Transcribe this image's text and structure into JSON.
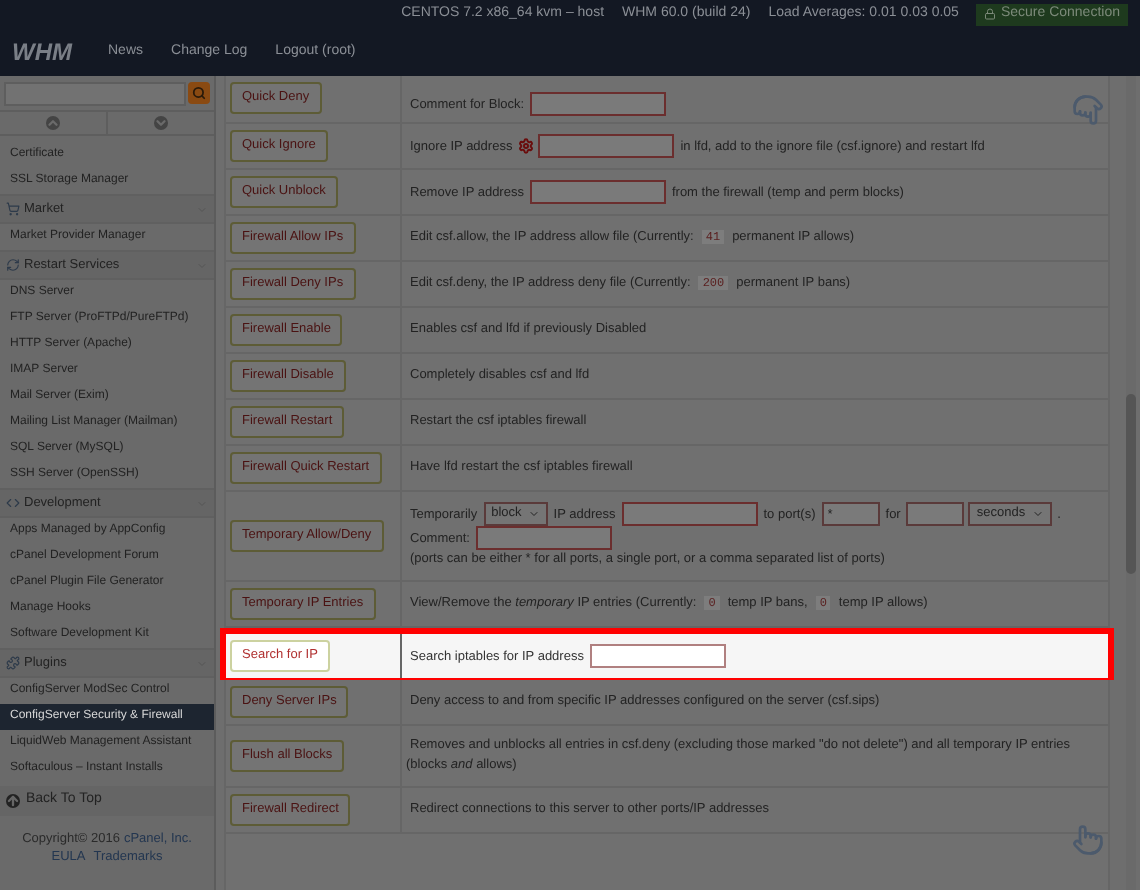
{
  "header": {
    "info": [
      "CENTOS 7.2 x86_64 kvm – host",
      "WHM 60.0 (build 24)",
      "Load Averages: 0.01 0.03 0.05"
    ],
    "secure": "Secure Connection",
    "logo": "WHM",
    "nav": [
      "News",
      "Change Log",
      "Logout (root)"
    ]
  },
  "sidebar": {
    "items": [
      {
        "kind": "item",
        "label": "Certificate",
        "selected": false
      },
      {
        "kind": "item",
        "label": "SSL Storage Manager",
        "selected": false
      },
      {
        "kind": "group",
        "label": "Market",
        "selected": false
      },
      {
        "kind": "item",
        "label": "Market Provider Manager",
        "selected": false
      },
      {
        "kind": "group",
        "label": "Restart Services",
        "selected": false
      },
      {
        "kind": "item",
        "label": "DNS Server",
        "selected": false
      },
      {
        "kind": "item",
        "label": "FTP Server (ProFTPd/PureFTPd)",
        "selected": false
      },
      {
        "kind": "item",
        "label": "HTTP Server (Apache)",
        "selected": false
      },
      {
        "kind": "item",
        "label": "IMAP Server",
        "selected": false
      },
      {
        "kind": "item",
        "label": "Mail Server (Exim)",
        "selected": false
      },
      {
        "kind": "item",
        "label": "Mailing List Manager (Mailman)",
        "selected": false
      },
      {
        "kind": "item",
        "label": "SQL Server (MySQL)",
        "selected": false
      },
      {
        "kind": "item",
        "label": "SSH Server (OpenSSH)",
        "selected": false
      },
      {
        "kind": "group",
        "label": "Development",
        "selected": false
      },
      {
        "kind": "item",
        "label": "Apps Managed by AppConfig",
        "selected": false
      },
      {
        "kind": "item",
        "label": "cPanel Development Forum",
        "selected": false
      },
      {
        "kind": "item",
        "label": "cPanel Plugin File Generator",
        "selected": false
      },
      {
        "kind": "item",
        "label": "Manage Hooks",
        "selected": false
      },
      {
        "kind": "item",
        "label": "Software Development Kit",
        "selected": false
      },
      {
        "kind": "group",
        "label": "Plugins",
        "selected": false
      },
      {
        "kind": "item",
        "label": "ConfigServer ModSec Control",
        "selected": false
      },
      {
        "kind": "item",
        "label": "ConfigServer Security & Firewall",
        "selected": true
      },
      {
        "kind": "item",
        "label": "LiquidWeb Management Assistant",
        "selected": false
      },
      {
        "kind": "item",
        "label": "Softaculous – Instant Installs",
        "selected": false
      }
    ],
    "back_to_top": "Back To Top",
    "copyright": "Copyright© 2016",
    "company": "cPanel, Inc.",
    "links": [
      "EULA",
      "Trademarks"
    ]
  },
  "rows": [
    {
      "button": "Quick Deny",
      "highlighted": false,
      "parts": [
        {
          "kind": "text",
          "text": "Comment for Block:"
        },
        {
          "kind": "field"
        }
      ]
    },
    {
      "button": "Quick Ignore",
      "highlighted": false,
      "parts": [
        {
          "kind": "text",
          "text": "Ignore IP address"
        },
        {
          "kind": "gear"
        },
        {
          "kind": "field"
        },
        {
          "kind": "text",
          "text": "in lfd, add to the ignore file (csf.ignore) and restart lfd"
        }
      ]
    },
    {
      "button": "Quick Unblock",
      "highlighted": false,
      "parts": [
        {
          "kind": "text",
          "text": "Remove IP address"
        },
        {
          "kind": "field"
        },
        {
          "kind": "text",
          "text": "from the firewall (temp and perm blocks)"
        }
      ]
    },
    {
      "button": "Firewall Allow IPs",
      "highlighted": false,
      "parts": [
        {
          "kind": "text",
          "text": "Edit csf.allow, the IP address allow file (Currently:"
        },
        {
          "kind": "code",
          "text": "41"
        },
        {
          "kind": "text",
          "text": "permanent IP allows)"
        }
      ]
    },
    {
      "button": "Firewall Deny IPs",
      "highlighted": false,
      "parts": [
        {
          "kind": "text",
          "text": "Edit csf.deny, the IP address deny file (Currently:"
        },
        {
          "kind": "code",
          "text": "200"
        },
        {
          "kind": "text",
          "text": "permanent IP bans)"
        }
      ]
    },
    {
      "button": "Firewall Enable",
      "highlighted": false,
      "parts": [
        {
          "kind": "text",
          "text": "Enables csf and lfd if previously Disabled"
        }
      ]
    },
    {
      "button": "Firewall Disable",
      "highlighted": false,
      "parts": [
        {
          "kind": "text",
          "text": "Completely disables csf and lfd"
        }
      ]
    },
    {
      "button": "Firewall Restart",
      "highlighted": false,
      "parts": [
        {
          "kind": "text",
          "text": "Restart the csf iptables firewall"
        }
      ]
    },
    {
      "button": "Firewall Quick Restart",
      "highlighted": false,
      "parts": [
        {
          "kind": "text",
          "text": "Have lfd restart the csf iptables firewall"
        }
      ]
    },
    {
      "button": "Temporary Allow/Deny",
      "highlighted": false,
      "parts": [
        {
          "kind": "text",
          "text": "Temporarily"
        },
        {
          "kind": "select",
          "value": "block"
        },
        {
          "kind": "text",
          "text": "IP address"
        },
        {
          "kind": "field"
        },
        {
          "kind": "text",
          "text": "to port(s)"
        },
        {
          "kind": "small-field",
          "value": "*"
        },
        {
          "kind": "text",
          "text": "for"
        },
        {
          "kind": "small-field"
        },
        {
          "kind": "select",
          "value": "seconds"
        },
        {
          "kind": "text",
          "text": "."
        },
        {
          "kind": "break"
        },
        {
          "kind": "text",
          "text": "Comment:"
        },
        {
          "kind": "field"
        },
        {
          "kind": "break"
        },
        {
          "kind": "text",
          "text": "(ports can be either * for all ports, a single port, or a comma separated list of ports)"
        }
      ]
    },
    {
      "button": "Temporary IP Entries",
      "highlighted": false,
      "parts": [
        {
          "kind": "text",
          "text": "View/Remove the *temporary* IP entries (Currently:"
        },
        {
          "kind": "code",
          "text": "0"
        },
        {
          "kind": "text",
          "text": "temp IP bans,"
        },
        {
          "kind": "code",
          "text": "0"
        },
        {
          "kind": "text",
          "text": "temp IP allows)"
        }
      ]
    },
    {
      "button": "Search for IP",
      "highlighted": true,
      "parts": [
        {
          "kind": "text",
          "text": "Search iptables for IP address"
        },
        {
          "kind": "field"
        }
      ]
    },
    {
      "button": "Deny Server IPs",
      "highlighted": false,
      "parts": [
        {
          "kind": "text",
          "text": "Deny access to and from specific IP addresses configured on the server (csf.sips)"
        }
      ]
    },
    {
      "button": "Flush all Blocks",
      "highlighted": false,
      "parts": [
        {
          "kind": "text",
          "text": "Removes and unblocks all entries in csf.deny (excluding those marked \"do not delete\") and all temporary IP entries (blocks *and* allows)"
        }
      ]
    },
    {
      "button": "Firewall Redirect",
      "highlighted": false,
      "parts": [
        {
          "kind": "text",
          "text": "Redirect connections to this server to other ports/IP addresses"
        }
      ]
    }
  ]
}
